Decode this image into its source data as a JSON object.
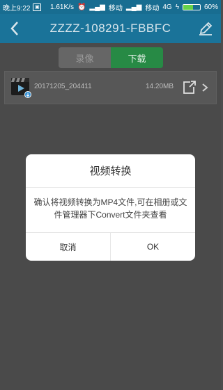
{
  "status_bar": {
    "time": "晚上9:22",
    "speed": "1.61K/s",
    "carrier1": "移动",
    "carrier2": "移动",
    "network": "4G",
    "battery": "60%",
    "battery_level": 0.6
  },
  "header": {
    "title": "ZZZZ-108291-FBBFC"
  },
  "tabs": [
    {
      "label": "录像",
      "active": false
    },
    {
      "label": "下载",
      "active": true
    }
  ],
  "files": [
    {
      "name": "20171205_204411",
      "size": "14.20MB"
    }
  ],
  "dialog": {
    "title": "视频转换",
    "message": "确认将视频转换为MP4文件,可在相册或文件管理器下Convert文件夹查看",
    "cancel_label": "取消",
    "ok_label": "OK"
  },
  "colors": {
    "header": "#1a7399",
    "status_bar": "#186d91",
    "active_tab": "#278a45",
    "overlay": "#4a4a4a"
  }
}
